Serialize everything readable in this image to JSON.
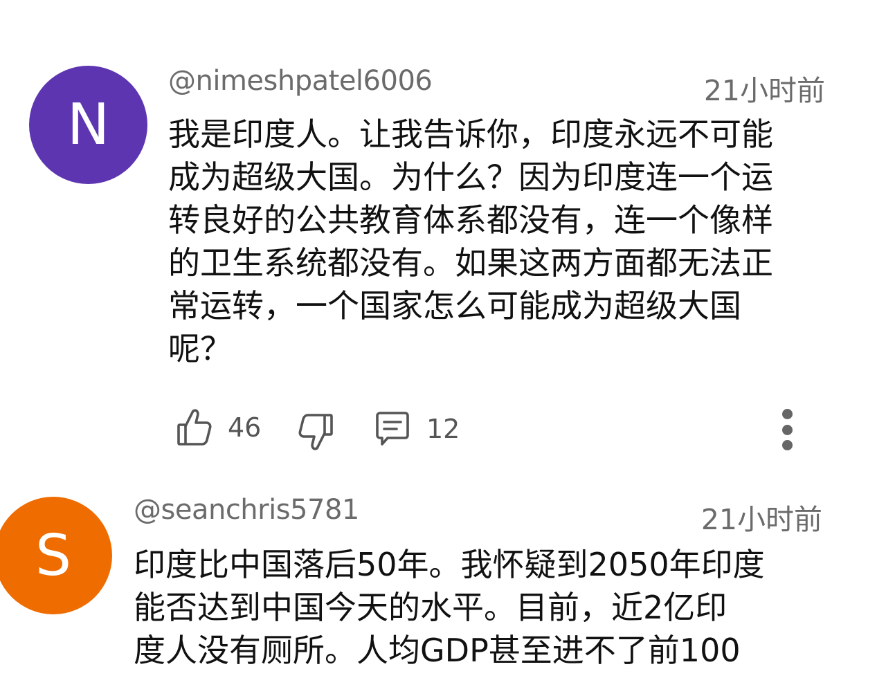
{
  "comments": [
    {
      "avatar_letter": "N",
      "avatar_color": "#5e35b1",
      "handle": "@nimeshpatel6006",
      "time": "21小时前",
      "lines": [
        "我是印度人。让我告诉你，印度永远不可能",
        "成为超级大国。为什么？因为印度连一个运",
        "转良好的公共教育体系都没有，连一个像样",
        "的卫生系统都没有。如果这两方面都无法正",
        "常运转，一个国家怎么可能成为超级大国",
        "呢？"
      ],
      "likes": "46",
      "replies": "12",
      "icons": {
        "like": "thumbs-up-icon",
        "dislike": "thumbs-down-icon",
        "reply": "comment-icon",
        "more": "more-vert-icon"
      }
    },
    {
      "avatar_letter": "S",
      "avatar_color": "#ef6c00",
      "handle": "@seanchris5781",
      "time": "21小时前",
      "lines": [
        "印度比中国落后50年。我怀疑到2050年印度",
        "能否达到中国今天的水平。目前，近2亿印",
        "度人没有厕所。人均GDP甚至进不了前100"
      ]
    }
  ],
  "colors": {
    "text_primary": "#111111",
    "text_secondary": "#6b6b6b",
    "icon": "#555555"
  }
}
